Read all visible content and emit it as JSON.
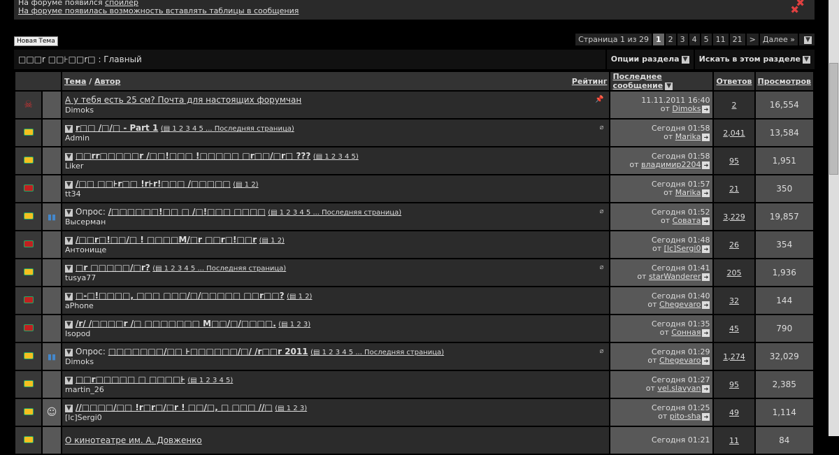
{
  "notice": {
    "line1_text": "На форуме появился ",
    "line1_link": "спойлер",
    "line2": "На форуме появилась возможность вставлять таблицы в сообщения"
  },
  "new_thread": "Новая Тема",
  "pager": {
    "label": "Страница 1 из 29",
    "pages": [
      "1",
      "2",
      "3",
      "4",
      "5",
      "11",
      "21",
      ">",
      "Далее »"
    ]
  },
  "section": {
    "title": "□□□r □□⊦□□r□ : Главный",
    "options": "Опции раздела",
    "search": "Искать в этом разделе"
  },
  "columns": {
    "topic": "Тема",
    "sep": " / ",
    "author": "Автор",
    "rating": "Рейтинг",
    "last": "Последнее сообщение",
    "replies": "Ответов",
    "views": "Просмотров"
  },
  "rows": [
    {
      "prefix": "",
      "title": "А у тебя есть 25 см? Почта для настоящих форумчан",
      "pages": "",
      "author": "Dimoks",
      "date": "11.11.2011 16:40",
      "by": "от ",
      "user": "Dimoks",
      "replies": "2",
      "views": "16,554",
      "status": "sticky",
      "rating": ""
    },
    {
      "prefix": "",
      "title": "r□□ /□/□ - Part 1",
      "pages": "(▤ 1 2 3 4 5 ... Последняя страница)",
      "author": "Admin",
      "date": "Сегодня 01:58",
      "by": "от ",
      "user": "Marika",
      "replies": "2,041",
      "views": "13,584",
      "status": "hot",
      "rating": ""
    },
    {
      "prefix": "",
      "title": "□□rr□□□□□r /□□!□□□ !□□□□□ □r□□/□r□ ???",
      "pages": "(▤ 1 2 3 4 5)",
      "author": "Liker",
      "date": "Сегодня 01:58",
      "by": "от ",
      "user": "владимир2204",
      "replies": "95",
      "views": "1,951",
      "status": "hot",
      "rating": ""
    },
    {
      "prefix": "",
      "title": "/□□ □□⊦r□□ !r⊦r!□□□ /□□□□□",
      "pages": "(▤ 1 2)",
      "author": "tt34",
      "date": "Сегодня 01:57",
      "by": "от ",
      "user": "Marika",
      "replies": "21",
      "views": "350",
      "status": "cold",
      "rating": ""
    },
    {
      "prefix": "Опрос: ",
      "title": "/□□□□□□!□□ □ /□!□□□ □□□□",
      "pages": "(▤ 1 2 3 4 5 ... Последняя страница)",
      "author": "Высерман",
      "date": "Сегодня 01:52",
      "by": "от ",
      "user": "Совата",
      "replies": "3,229",
      "views": "19,857",
      "status": "hot",
      "rating": "poll"
    },
    {
      "prefix": "",
      "title": "/□□r□!□□/□ ! □□□□M/□r □□r□!□□r",
      "pages": "(▤ 1 2)",
      "author": "Антонище",
      "date": "Сегодня 01:48",
      "by": "от ",
      "user": "[lc]Sergi0",
      "replies": "26",
      "views": "354",
      "status": "cold",
      "rating": ""
    },
    {
      "prefix": "",
      "title": "□r □□□□□/□r?",
      "pages": "(▤ 1 2 3 4 5 ... Последняя страница)",
      "author": "tusya77",
      "date": "Сегодня 01:41",
      "by": "от ",
      "user": "starWanderer",
      "replies": "205",
      "views": "1,936",
      "status": "hot",
      "rating": ""
    },
    {
      "prefix": "",
      "title": "□-□!□□□□, □□□ □□□/□/□□□□□ □□r□□?",
      "pages": "(▤ 1 2)",
      "author": "aPhone",
      "date": "Сегодня 01:40",
      "by": "от ",
      "user": "Chegevaro",
      "replies": "32",
      "views": "144",
      "status": "cold",
      "rating": ""
    },
    {
      "prefix": "",
      "title": "/r/ /□□□□r /□ □□□□□□□ M□□/□/□□□□.",
      "pages": "(▤ 1 2 3)",
      "author": "Isopod",
      "date": "Сегодня 01:35",
      "by": "от ",
      "user": "Сонная",
      "replies": "45",
      "views": "790",
      "status": "cold",
      "rating": ""
    },
    {
      "prefix": "Опрос: ",
      "title": "□□□□□□□/□□ ⊦□□□□□□/□/ /r□□r 2011",
      "pages": "(▤ 1 2 3 4 5 ... Последняя страница)",
      "author": "Dimoks",
      "date": "Сегодня 01:29",
      "by": "от ",
      "user": "Chegevaro",
      "replies": "1,274",
      "views": "32,029",
      "status": "hot",
      "rating": "poll"
    },
    {
      "prefix": "",
      "title": "□□r□□□□□ □ □□□□⊦",
      "pages": "(▤ 1 2 3 4 5)",
      "author": "martin_26",
      "date": "Сегодня 01:27",
      "by": "от ",
      "user": "vel.slavyan",
      "replies": "95",
      "views": "2,385",
      "status": "hot",
      "rating": ""
    },
    {
      "prefix": "",
      "title": "//□□□□/□□ !r□r□/□r ! □□/□, □ □□□ //□",
      "pages": "(▤ 1 2 3)",
      "author": "[lc]Sergi0",
      "date": "Сегодня 01:25",
      "by": "от ",
      "user": "pito-sha",
      "replies": "49",
      "views": "1,114",
      "status": "hot",
      "rating": "smile"
    },
    {
      "prefix": "",
      "title": "О кинотеатре им. А. Довженко",
      "pages": "",
      "author": "",
      "date": "Сегодня 01:21",
      "by": "",
      "user": "",
      "replies": "11",
      "views": "84",
      "status": "hot",
      "rating": ""
    }
  ]
}
